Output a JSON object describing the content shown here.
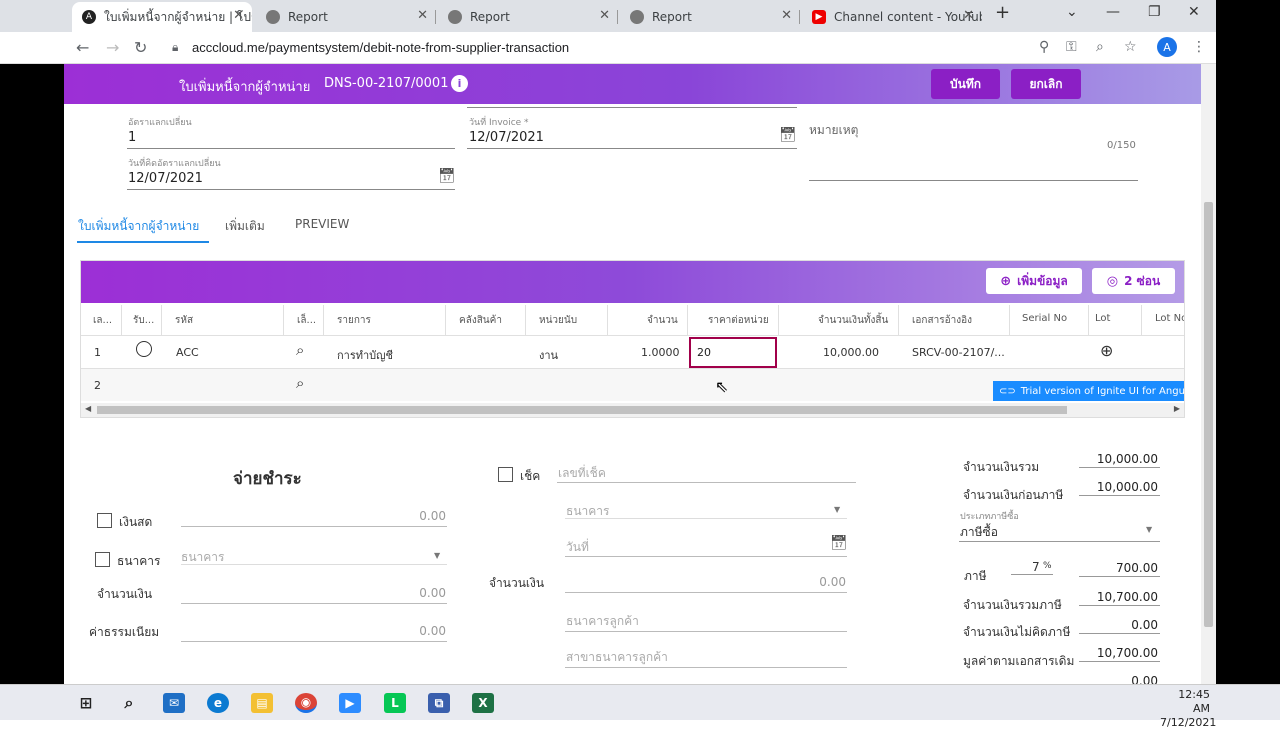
{
  "browser": {
    "tabs": [
      {
        "title": "ใบเพิ่มหนี้จากผู้จำหน่าย | โปรแ",
        "icon": "angular-icon",
        "active": true
      },
      {
        "title": "Report",
        "icon": "globe-icon"
      },
      {
        "title": "Report",
        "icon": "globe-icon"
      },
      {
        "title": "Report",
        "icon": "globe-icon"
      },
      {
        "title": "Channel content - YouTube",
        "icon": "youtube-icon"
      }
    ],
    "url": "acccloud.me/paymentsystem/debit-note-from-supplier-transaction",
    "avatar": "A"
  },
  "header": {
    "title": "ใบเพิ่มหนี้จากผู้จำหน่าย",
    "doc_no": "DNS-00-2107/0001",
    "save_label": "บันทึก",
    "cancel_label": "ยกเลิก"
  },
  "form": {
    "exchange_rate_label": "อัตราแลกเปลี่ยน",
    "exchange_rate": "1",
    "exchange_date_label": "วันที่คิดอัตราแลกเปลี่ยน",
    "exchange_date": "12/07/2021",
    "invoice_date_label": "วันที่ Invoice *",
    "invoice_date": "12/07/2021",
    "remark_label": "หมายเหตุ",
    "remark_counter": "0/150"
  },
  "page_tabs": [
    "ใบเพิ่มหนี้จากผู้จำหน่าย",
    "เพิ่มเติม",
    "PREVIEW"
  ],
  "grid": {
    "add_label": "เพิ่มข้อมูล",
    "hide_label": "2 ซ่อน",
    "columns": [
      "เล...",
      "รับ...",
      "รหัส",
      "เล็...",
      "รายการ",
      "คลังสินค้า",
      "หน่วยนับ",
      "จำนวน",
      "ราคาต่อหน่วย",
      "จำนวนเงินทั้งสิ้น",
      "เอกสารอ้างอิง",
      "Serial No",
      "Lot",
      "Lot No"
    ],
    "rows": [
      {
        "no": "1",
        "code": "ACC",
        "item": "การทำบัญชี",
        "unit": "งาน",
        "qty": "1.0000",
        "price": "20",
        "amount": "10,000.00",
        "ref": "SRCV-00-2107/..."
      },
      {
        "no": "2"
      }
    ],
    "trial_text": "Trial version of Ignite UI for Angular"
  },
  "payment": {
    "title": "จ่ายชำระ",
    "cash_label": "เงินสด",
    "cash_value": "0.00",
    "bank_label": "ธนาคาร",
    "bank_placeholder": "ธนาคาร",
    "amount_label": "จำนวนเงิน",
    "amount_value": "0.00",
    "fee_label": "ค่าธรรมเนียม",
    "fee_value": "0.00",
    "cheque_label": "เช็ค",
    "cheque_no_placeholder": "เลขที่เช็ค",
    "cheque_bank_placeholder": "ธนาคาร",
    "cheque_date_placeholder": "วันที่",
    "cheque_amount_label": "จำนวนเงิน",
    "cheque_amount_value": "0.00",
    "customer_bank_placeholder": "ธนาคารลูกค้า",
    "customer_branch_placeholder": "สาขาธนาคารลูกค้า"
  },
  "summary": {
    "total_label": "จำนวนเงินรวม",
    "total": "10,000.00",
    "before_tax_label": "จำนวนเงินก่อนภาษี",
    "before_tax": "10,000.00",
    "tax_type_label": "ประเภทภาษีซื้อ",
    "tax_type": "ภาษีซื้อ",
    "tax_label": "ภาษี",
    "tax_rate": "7",
    "tax_rate_unit": "%",
    "tax": "700.00",
    "with_tax_label": "จำนวนเงินรวมภาษี",
    "with_tax": "10,700.00",
    "no_tax_label": "จำนวนเงินไม่คิดภาษี",
    "no_tax": "0.00",
    "orig_label": "มูลค่าตามเอกสารเดิม",
    "orig": "10,700.00",
    "next_value": "0.00"
  },
  "taskbar": {
    "time": "12:45 AM",
    "date": "7/12/2021"
  }
}
